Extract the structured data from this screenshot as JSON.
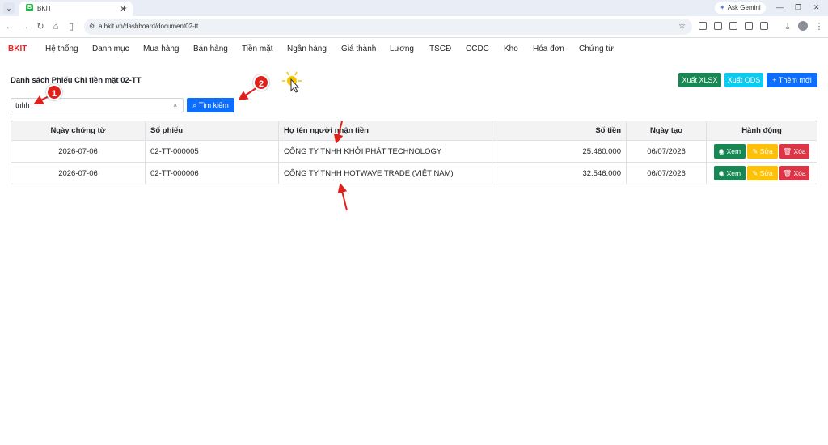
{
  "browser": {
    "tab_title": "BKIT",
    "tab_favicon": "B",
    "url": "a.bkit.vn/dashboard/document02-tt",
    "gemini_label": "Ask Gemini"
  },
  "navbar": {
    "brand": "BKIT",
    "items": [
      "Hệ thống",
      "Danh mục",
      "Mua hàng",
      "Bán hàng",
      "Tiền mặt",
      "Ngân hàng",
      "Giá thành",
      "Lương",
      "TSCĐ",
      "CCDC",
      "Kho",
      "Hóa đơn",
      "Chứng từ"
    ]
  },
  "page": {
    "title": "Danh sách Phiếu Chi tiền mặt 02-TT",
    "export_xlsx": "Xuất XLSX",
    "export_ods": "Xuất ODS",
    "add_new": "+ Thêm mới"
  },
  "search": {
    "value": "tnhh",
    "clear": "×",
    "button": "Tìm kiếm"
  },
  "table": {
    "headers": {
      "date": "Ngày chứng từ",
      "number": "Số phiếu",
      "name": "Họ tên người nhận tiền",
      "amount": "Số tiền",
      "created": "Ngày tạo",
      "actions": "Hành động"
    },
    "rows": [
      {
        "date": "2026-07-06",
        "number": "02-TT-000005",
        "name": "CÔNG TY TNHH KHỞI PHÁT TECHNOLOGY",
        "amount": "25.460.000",
        "created": "06/07/2026"
      },
      {
        "date": "2026-07-06",
        "number": "02-TT-000006",
        "name": "CÔNG TY TNHH HOTWAVE TRADE (VIỆT NAM)",
        "amount": "32.546.000",
        "created": "06/07/2026"
      }
    ],
    "actions": {
      "view": "Xem",
      "edit": "Sửa",
      "delete": "Xóa"
    }
  },
  "annotations": {
    "marker1": "1",
    "marker2": "2",
    "arrow_color": "#e0201b"
  }
}
